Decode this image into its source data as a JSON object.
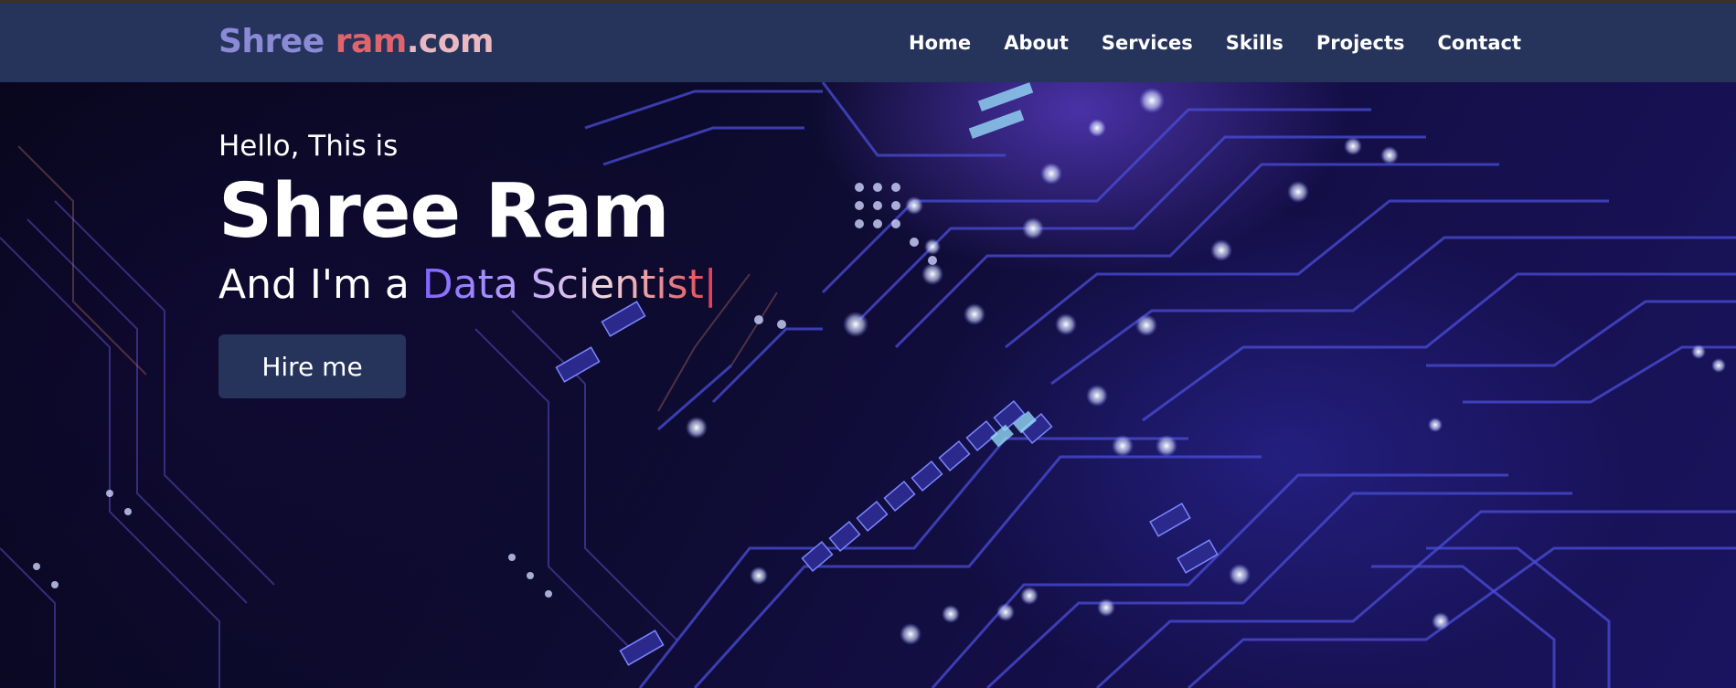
{
  "logo": {
    "part1": "Shree ",
    "part2": "ram",
    "part3": ".com"
  },
  "nav": {
    "items": [
      {
        "label": "Home"
      },
      {
        "label": "About"
      },
      {
        "label": "Services"
      },
      {
        "label": "Skills"
      },
      {
        "label": "Projects"
      },
      {
        "label": "Contact"
      }
    ]
  },
  "hero": {
    "greeting": "Hello, This is",
    "name": "Shree Ram",
    "role_prefix": "And I'm a ",
    "role_typed": "Data Scientist",
    "cursor": "|",
    "button_label": "Hire me"
  },
  "colors": {
    "navbar": "#26335a",
    "accent_purple": "#7f63ff",
    "accent_red": "#e2505a"
  }
}
